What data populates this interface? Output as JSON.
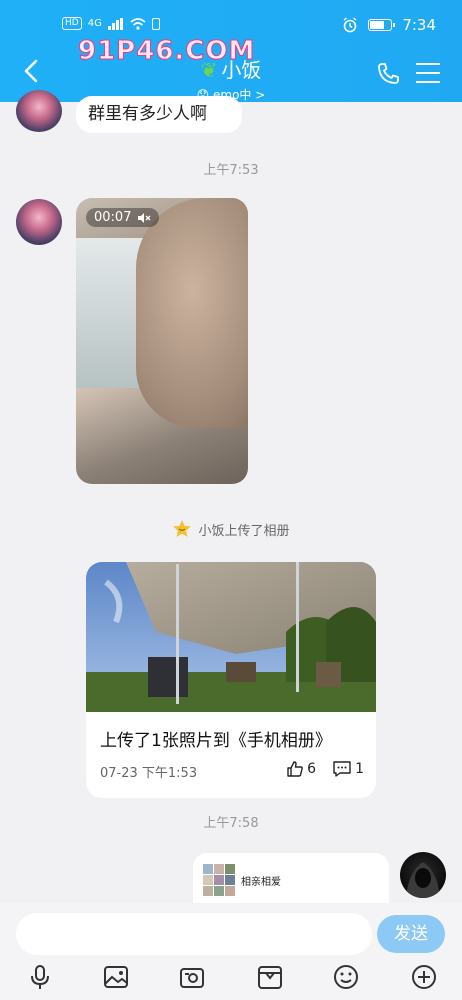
{
  "status_bar": {
    "left_tags": [
      "HD",
      "4G"
    ],
    "time": "7:34"
  },
  "header": {
    "title": "小饭",
    "subtitle": "emo中 >",
    "watermark": "91P46.COM"
  },
  "messages": {
    "text_message": "群里有多少人啊",
    "time_1": "上午7:53",
    "video_duration": "00:07",
    "system_notice": "小饭上传了相册",
    "album": {
      "title": "上传了1张照片到《手机相册》",
      "date": "07-23 下午1:53",
      "likes": "6",
      "comments": "1"
    },
    "time_2": "上午7:58",
    "share_label": "相亲相爱"
  },
  "input": {
    "placeholder": "",
    "send_label": "发送"
  },
  "toolbar": {
    "icons": [
      "microphone-icon",
      "image-icon",
      "camera-icon",
      "folder-icon",
      "emoji-icon",
      "plus-icon"
    ]
  },
  "colors": {
    "header": "#1fb0f7",
    "send_button": "#8cc9f5",
    "background": "#f1f1f3"
  }
}
